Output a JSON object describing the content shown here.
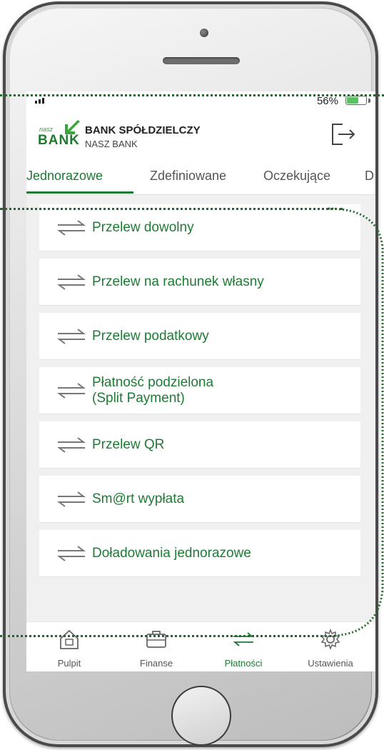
{
  "colors": {
    "brand_green": "#1e7b34",
    "annotation": "#1f6b2a"
  },
  "status_bar": {
    "battery": "56%",
    "battery_level": 0.56
  },
  "header": {
    "logo_small": "nasz",
    "logo_big": "BANK",
    "bank_name": "BANK SPÓŁDZIELCZY",
    "bank_sub": "NASZ BANK",
    "logout_icon": "logout-icon"
  },
  "tabs": [
    {
      "label": "Jednorazowe",
      "active": true
    },
    {
      "label": "Zdefiniowane",
      "active": false
    },
    {
      "label": "Oczekujące",
      "active": false
    },
    {
      "label": "D",
      "active": false
    }
  ],
  "items": [
    {
      "label": "Przelew dowolny",
      "icon": "transfer-arrows-icon"
    },
    {
      "label": "Przelew na rachunek własny",
      "icon": "transfer-arrows-icon"
    },
    {
      "label": "Przelew podatkowy",
      "icon": "transfer-arrows-icon"
    },
    {
      "label_line1": "Płatność podzielona",
      "label_line2": "(Split Payment)",
      "icon": "transfer-arrows-icon"
    },
    {
      "label": "Przelew QR",
      "icon": "transfer-arrows-icon"
    },
    {
      "label": "Sm@rt wypłata",
      "icon": "transfer-arrows-icon"
    },
    {
      "label": "Doładowania jednorazowe",
      "icon": "transfer-arrows-icon"
    }
  ],
  "bottom_nav": [
    {
      "label": "Pulpit",
      "icon": "home-icon",
      "active": false
    },
    {
      "label": "Finanse",
      "icon": "wallet-icon",
      "active": false
    },
    {
      "label": "Płatności",
      "icon": "transfer-arrows-icon",
      "active": true
    },
    {
      "label": "Ustawienia",
      "icon": "gear-icon",
      "active": false
    }
  ]
}
